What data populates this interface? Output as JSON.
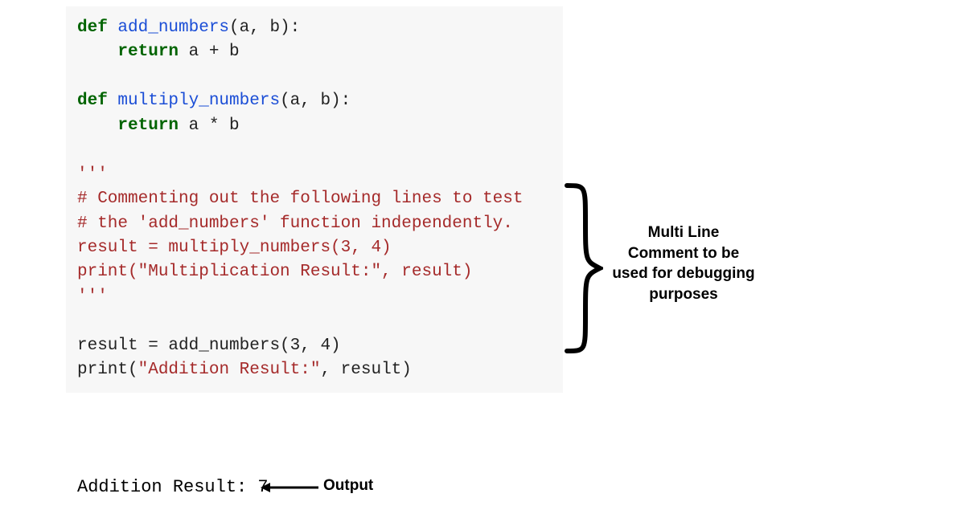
{
  "code": {
    "def1_kw": "def",
    "def1_fn": " add_numbers",
    "def1_params": "(a, b):",
    "ret1_kw": "return",
    "ret1_expr": " a + b",
    "def2_kw": "def",
    "def2_fn": " multiply_numbers",
    "def2_params": "(a, b):",
    "ret2_kw": "return",
    "ret2_expr": " a * b",
    "triple1": "'''",
    "commented1": "# Commenting out the following lines to test",
    "commented2": "# the 'add_numbers' function independently.",
    "commented3": "result = multiply_numbers(3, 4)",
    "commented4": "print(\"Multiplication Result:\", result)",
    "triple2": "'''",
    "result_line": "result = add_numbers(3, 4)",
    "print_pre": "print(",
    "print_str": "\"Addition Result:\"",
    "print_post": ", result)"
  },
  "output_text": "Addition Result: 7",
  "output_label": "Output",
  "annotation_text": "Multi Line Comment to be used for debugging purposes"
}
